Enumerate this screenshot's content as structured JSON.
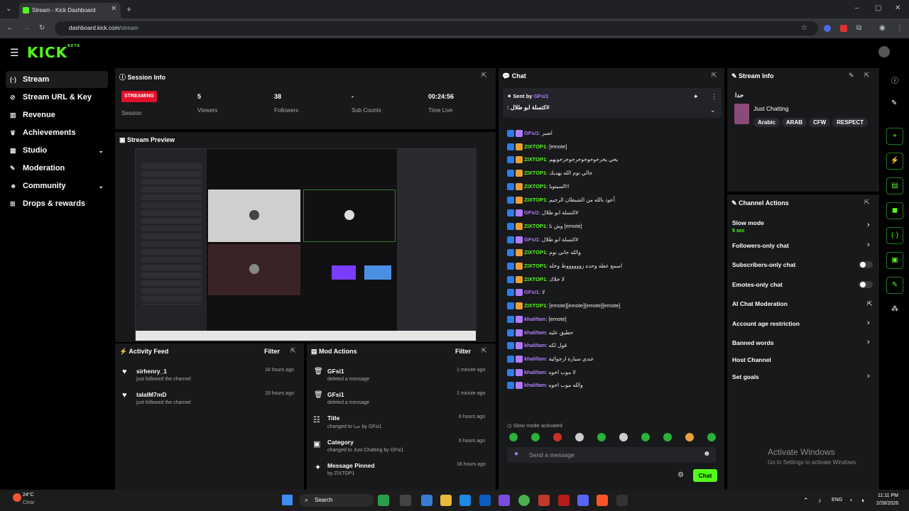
{
  "browser": {
    "tab_title": "Stream - Kick Dashboard",
    "url_host": "dashboard.kick.com",
    "url_path": "/stream"
  },
  "app": {
    "logo": "KICK",
    "logo_badge": "BETA",
    "accent": "#53fc18"
  },
  "sidebar": {
    "items": [
      {
        "label": "Stream",
        "icon": "stream-icon"
      },
      {
        "label": "Stream URL & Key",
        "icon": "link-icon"
      },
      {
        "label": "Revenue",
        "icon": "revenue-icon"
      },
      {
        "label": "Achievements",
        "icon": "trophy-icon"
      },
      {
        "label": "Studio",
        "icon": "studio-icon"
      },
      {
        "label": "Moderation",
        "icon": "wrench-icon"
      },
      {
        "label": "Community",
        "icon": "community-icon"
      },
      {
        "label": "Drops & rewards",
        "icon": "gift-icon"
      }
    ]
  },
  "session": {
    "title": "Session Info",
    "status": "STREAMING",
    "status_label": "Session",
    "stats": [
      {
        "value": "5",
        "label": "Viewers"
      },
      {
        "value": "38",
        "label": "Followers"
      },
      {
        "value": "-",
        "label": "Sub Counts"
      },
      {
        "value": "00:24:56",
        "label": "Time Live"
      }
    ]
  },
  "preview": {
    "title": "Stream Preview"
  },
  "activity": {
    "title": "Activity Feed",
    "filter": "Filter",
    "items": [
      {
        "name": "sirhenry_1",
        "sub": "just followed the channel",
        "time": "18 hours ago"
      },
      {
        "name": "talalM7mD",
        "sub": "just followed the channel",
        "time": "19 hours ago"
      }
    ]
  },
  "mod": {
    "title": "Mod Actions",
    "filter": "Filter",
    "items": [
      {
        "name": "GFsi1",
        "sub": "deleted a message",
        "time": "1 minute ago",
        "icon": "trash-icon"
      },
      {
        "name": "GFsi1",
        "sub": "deleted a message",
        "time": "1 minute ago",
        "icon": "trash-icon"
      },
      {
        "name": "Title",
        "sub": "changed to حدا by GFsi1",
        "time": "6 hours ago",
        "icon": "title-icon"
      },
      {
        "name": "Category",
        "sub": "changed to Just Chatting by GFsi1",
        "time": "6 hours ago",
        "icon": "category-icon"
      },
      {
        "name": "Message Pinned",
        "sub": "by ZIXTOP1",
        "time": "18 hours ago",
        "icon": "pin-icon"
      }
    ]
  },
  "chat": {
    "title": "Chat",
    "pinned_by_label": "Sent by",
    "pinned_user": "GFsi1",
    "pinned_text": ": كتسلة ابو طلال#",
    "slow_mode": "Slow mode activated",
    "placeholder": "Send a message",
    "send": "Chat",
    "messages": [
      {
        "user": "GFsi1",
        "text": ": اصبر",
        "color": "p"
      },
      {
        "user": "ZIXTOP1",
        "text": ": [emote]",
        "color": "g"
      },
      {
        "user": "ZIXTOP1",
        "text": ": يخي يخزخوخوخوخزخوخزخوبهم",
        "color": "g"
      },
      {
        "user": "ZIXTOP1",
        "text": ": جالي نوم الله يهديك",
        "color": "g"
      },
      {
        "user": "ZIXTOP1",
        "text": ": السيتويا!!",
        "color": "g"
      },
      {
        "user": "ZIXTOP1",
        "text": ": أعوذ بالله من الشيطان الرجيم",
        "color": "g"
      },
      {
        "user": "GFsi1",
        "text": ": كتسلة ابو طلال#",
        "color": "p"
      },
      {
        "user": "ZIXTOP1",
        "text": ": وش تا [emote]",
        "color": "g"
      },
      {
        "user": "GFsi1",
        "text": ": كتسلة ابو طلال#",
        "color": "p"
      },
      {
        "user": "ZIXTOP1",
        "text": ": والله جاني نوم",
        "color": "g"
      },
      {
        "user": "ZIXTOP1",
        "text": ": اسمع عطه وحده زووووووط وخله",
        "color": "g"
      },
      {
        "user": "ZIXTOP1",
        "text": ": لا خلاك",
        "color": "g"
      },
      {
        "user": "GFsi1",
        "text": ": لا",
        "color": "p"
      },
      {
        "user": "ZIXTOP1",
        "text": ": [emote][emote][emote][emote]",
        "color": "g"
      },
      {
        "user": "khalifam",
        "text": ": [emote]",
        "color": "p"
      },
      {
        "user": "khalifam",
        "text": ": حطيق عليه",
        "color": "p"
      },
      {
        "user": "khalifam",
        "text": ": قول لكه",
        "color": "p"
      },
      {
        "user": "khalifam",
        "text": ": عندي سيارة ارجوائية",
        "color": "p"
      },
      {
        "user": "khalifam",
        "text": ": لا موب اخوه",
        "color": "p"
      },
      {
        "user": "khalifam",
        "text": ": والله موب اخوه",
        "color": "p"
      }
    ]
  },
  "stream_info": {
    "title": "Stream Info",
    "stream_title": "حدا",
    "category": "Just Chatting",
    "tags": [
      "Arabic",
      "ARAB",
      "CFW",
      "RESPECT"
    ]
  },
  "channel_actions": {
    "title": "Channel Actions",
    "items": [
      {
        "label": "Slow mode",
        "sub": "5 sec",
        "control": "chevron"
      },
      {
        "label": "Followers-only chat",
        "sub": "",
        "control": "chevron"
      },
      {
        "label": "Subscribers-only chat",
        "sub": "",
        "control": "toggle"
      },
      {
        "label": "Emotes-only chat",
        "sub": "",
        "control": "toggle"
      },
      {
        "label": "AI Chat Moderation",
        "sub": "",
        "control": "external"
      },
      {
        "label": "Account age restriction",
        "sub": "",
        "control": "chevron"
      },
      {
        "label": "Banned words",
        "sub": "",
        "control": "chevron"
      },
      {
        "label": "Host Channel",
        "sub": "",
        "control": "none"
      },
      {
        "label": "Set goals",
        "sub": "",
        "control": "chevron"
      }
    ]
  },
  "watermark": {
    "line1": "Activate Windows",
    "line2": "Go to Settings to activate Windows."
  },
  "taskbar": {
    "weather_temp": "24°C",
    "weather_desc": "Clear",
    "search": "Search",
    "lang": "ENG",
    "time": "11:11 PM",
    "date": "2/28/2026"
  }
}
